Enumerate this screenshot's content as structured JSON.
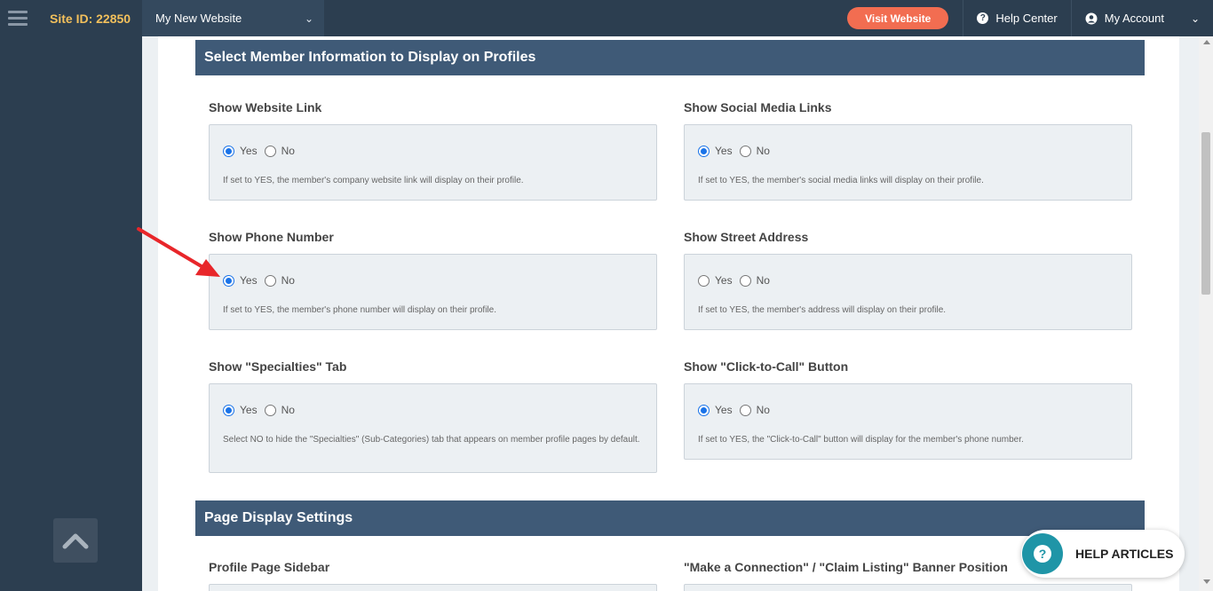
{
  "topbar": {
    "site_id": "Site ID: 22850",
    "website_select": "My New Website",
    "visit_button": "Visit Website",
    "help_center": "Help Center",
    "my_account": "My Account"
  },
  "sections": {
    "member_info_title": "Select Member Information to Display on Profiles",
    "page_display_title": "Page Display Settings"
  },
  "radio_labels": {
    "yes": "Yes",
    "no": "No"
  },
  "fields": [
    {
      "label": "Show Website Link",
      "value": "Yes",
      "help": "If set to YES, the member's company website link will display on their profile."
    },
    {
      "label": "Show Social Media Links",
      "value": "Yes",
      "help": "If set to YES, the member's social media links will display on their profile."
    },
    {
      "label": "Show Phone Number",
      "value": "Yes",
      "help": "If set to YES, the member's phone number will display on their profile."
    },
    {
      "label": "Show Street Address",
      "value": "",
      "help": "If set to YES, the member's address will display on their profile."
    },
    {
      "label": "Show \"Specialties\" Tab",
      "value": "Yes",
      "help": "Select NO to hide the \"Specialties\" (Sub-Categories) tab that appears on member profile pages by default."
    },
    {
      "label": "Show \"Click-to-Call\" Button",
      "value": "Yes",
      "help": "If set to YES, the \"Click-to-Call\" button will display for the member's phone number."
    }
  ],
  "page_display_fields": [
    {
      "label": "Profile Page Sidebar"
    },
    {
      "label": "\"Make a Connection\" / \"Claim Listing\" Banner Position"
    }
  ],
  "help_widget": {
    "label": "HELP ARTICLES"
  },
  "colors": {
    "topbar": "#2c3e50",
    "section_bar": "#3f5a77",
    "site_id": "#f3c05c",
    "visit_button": "#f26d51",
    "radio_checked": "#1a73e8",
    "help_circle": "#1f95a7",
    "annotation_arrow": "#e8262a"
  },
  "icons": {
    "menu": "hamburger-icon",
    "help": "question-circle-icon",
    "account": "user-circle-icon",
    "scroll_top": "chevron-up-icon"
  }
}
